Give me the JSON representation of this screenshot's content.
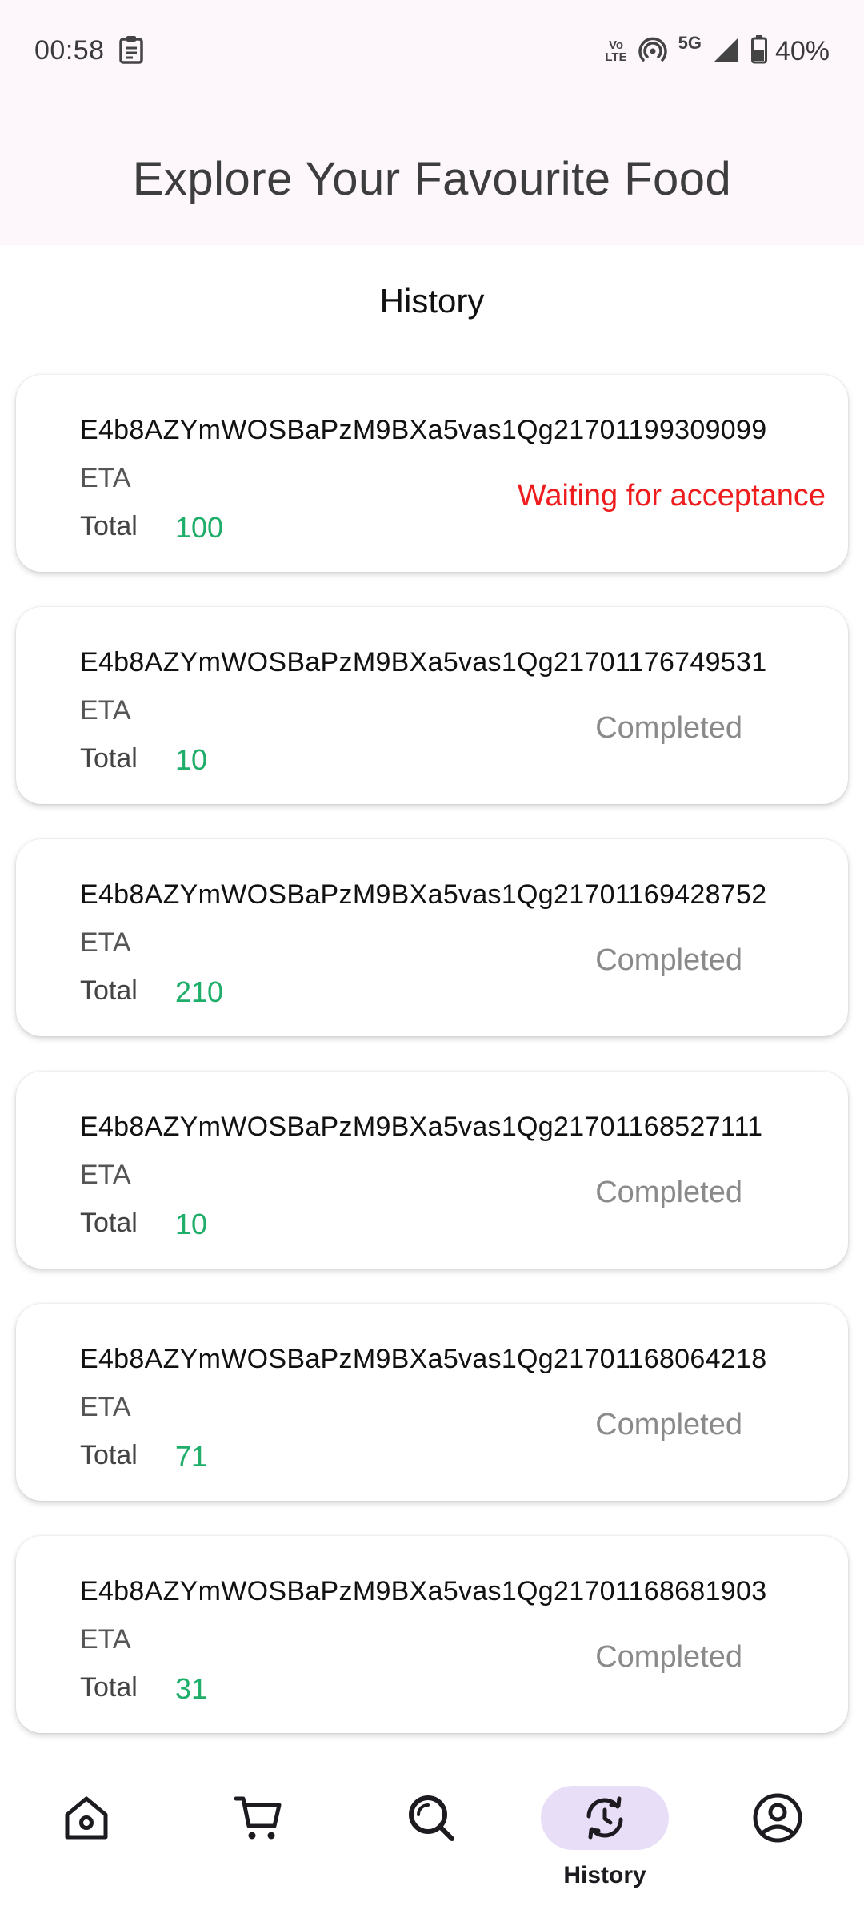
{
  "status_bar": {
    "time": "00:58",
    "network": "5G",
    "volte_top": "Vo",
    "volte_bottom": "LTE",
    "battery": "40%"
  },
  "header": {
    "title": "Explore Your Favourite Food"
  },
  "page": {
    "title": "History"
  },
  "labels": {
    "eta": "ETA",
    "total": "Total"
  },
  "orders": [
    {
      "id": "E4b8AZYmWOSBaPzM9BXa5vas1Qg21701199309099",
      "total": "100",
      "status": "Waiting for acceptance"
    },
    {
      "id": "E4b8AZYmWOSBaPzM9BXa5vas1Qg21701176749531",
      "total": "10",
      "status": "Completed"
    },
    {
      "id": "E4b8AZYmWOSBaPzM9BXa5vas1Qg21701169428752",
      "total": "210",
      "status": "Completed"
    },
    {
      "id": "E4b8AZYmWOSBaPzM9BXa5vas1Qg21701168527111",
      "total": "10",
      "status": "Completed"
    },
    {
      "id": "E4b8AZYmWOSBaPzM9BXa5vas1Qg21701168064218",
      "total": "71",
      "status": "Completed"
    },
    {
      "id": "E4b8AZYmWOSBaPzM9BXa5vas1Qg21701168681903",
      "total": "31",
      "status": "Completed"
    }
  ],
  "nav": {
    "items": [
      {
        "icon": "home-icon"
      },
      {
        "icon": "cart-icon"
      },
      {
        "icon": "search-icon"
      },
      {
        "icon": "history-icon",
        "label": "History",
        "active": true
      },
      {
        "icon": "profile-icon"
      }
    ]
  },
  "colors": {
    "total_value": "#1fae6a",
    "status_waiting": "#ee1c1c",
    "status_completed": "#8a8a8a",
    "active_pill": "#e8def8"
  }
}
